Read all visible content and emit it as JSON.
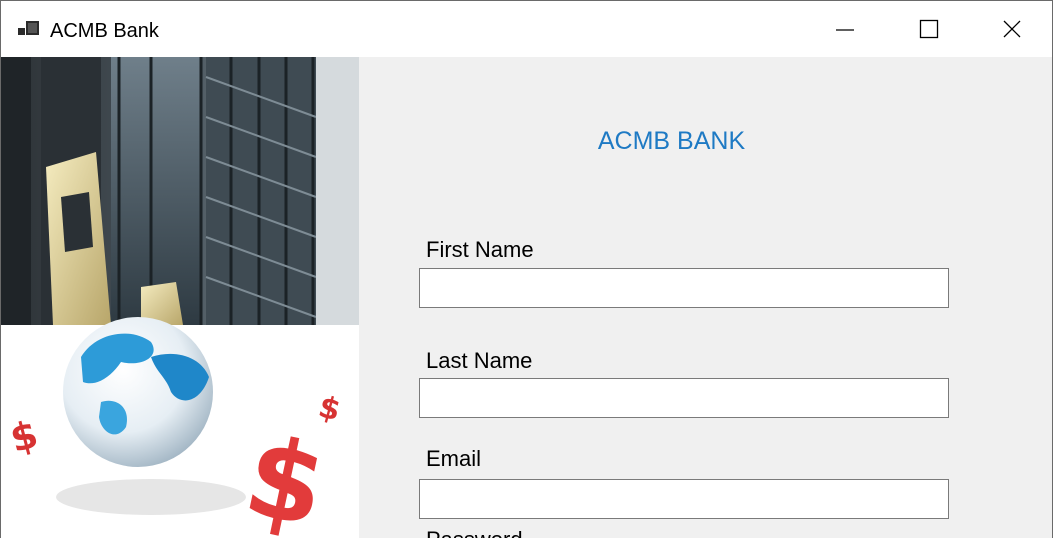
{
  "window": {
    "title": "ACMB Bank",
    "icon": "app-window-icon",
    "controls": [
      "minimize-icon",
      "maximize-icon",
      "close-icon"
    ]
  },
  "form": {
    "heading": "ACMB BANK",
    "heading_color": "#1e7ac4",
    "fields": [
      {
        "label": "First Name",
        "value": ""
      },
      {
        "label": "Last Name",
        "value": ""
      },
      {
        "label": "Email",
        "value": ""
      },
      {
        "label": "Password",
        "value": ""
      }
    ]
  }
}
